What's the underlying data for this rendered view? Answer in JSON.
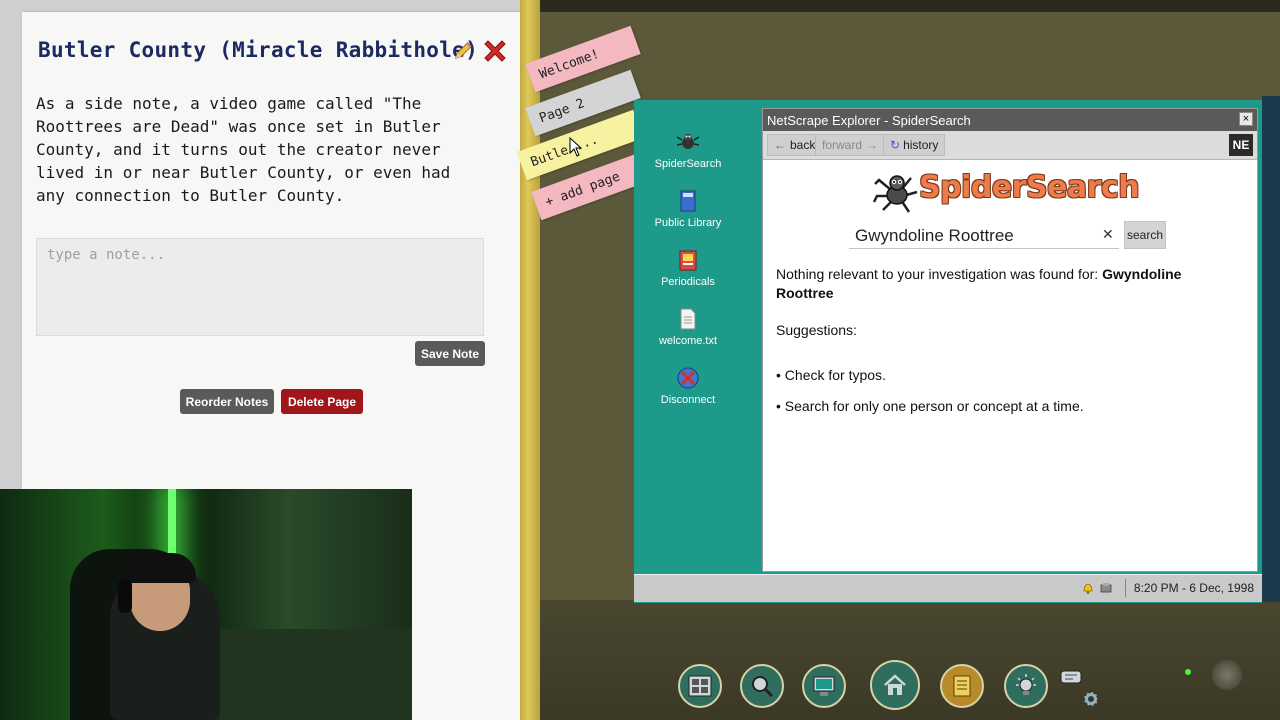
{
  "notebook": {
    "title": "Butler County (Miracle Rabbithole)",
    "note_text": "As a side note, a video game called \"The Roottrees are Dead\" was once set in Butler County, and it turns out the creator never lived in or near Butler County, or even had any connection to Butler County.",
    "input_placeholder": "type a note...",
    "save_label": "Save Note",
    "reorder_label": "Reorder Notes",
    "delete_label": "Delete Page",
    "tabs": [
      {
        "label": "Welcome!"
      },
      {
        "label": "Page 2"
      },
      {
        "label": "Butler..."
      },
      {
        "label": "+ add page"
      }
    ]
  },
  "desktop": {
    "icons": [
      {
        "label": "SpiderSearch",
        "icon": "spider-icon"
      },
      {
        "label": "Public Library",
        "icon": "book-icon"
      },
      {
        "label": "Periodicals",
        "icon": "magazine-icon"
      },
      {
        "label": "welcome.txt",
        "icon": "document-icon"
      },
      {
        "label": "Disconnect",
        "icon": "disconnect-icon"
      }
    ],
    "clock": "8:20 PM - 6 Dec, 1998"
  },
  "browser": {
    "title": "NetScrape Explorer - SpiderSearch",
    "close_glyph": "×",
    "back_label": "back",
    "forward_label": "forward",
    "history_label": "history",
    "logo": "NE",
    "brand": "SpiderSearch",
    "query": "Gwyndoline Roottree",
    "clear_glyph": "✕",
    "search_label": "search",
    "result_prefix": "Nothing relevant to your investigation was found for: ",
    "result_query": "Gwyndoline Roottree",
    "suggestions_heading": "Suggestions:",
    "suggestions": [
      "• Check for typos.",
      "• Search for only one person or concept at a time."
    ]
  },
  "dock": [
    {
      "name": "evidence-board-icon"
    },
    {
      "name": "investigate-icon"
    },
    {
      "name": "computer-icon"
    },
    {
      "name": "home-icon"
    },
    {
      "name": "notebook-icon"
    },
    {
      "name": "hints-icon"
    }
  ],
  "colors": {
    "desktop_teal": "#1e9a8a",
    "delete_red": "#a0161a",
    "title_navy": "#1c2a63",
    "brand_orange": "#f07b4a"
  }
}
